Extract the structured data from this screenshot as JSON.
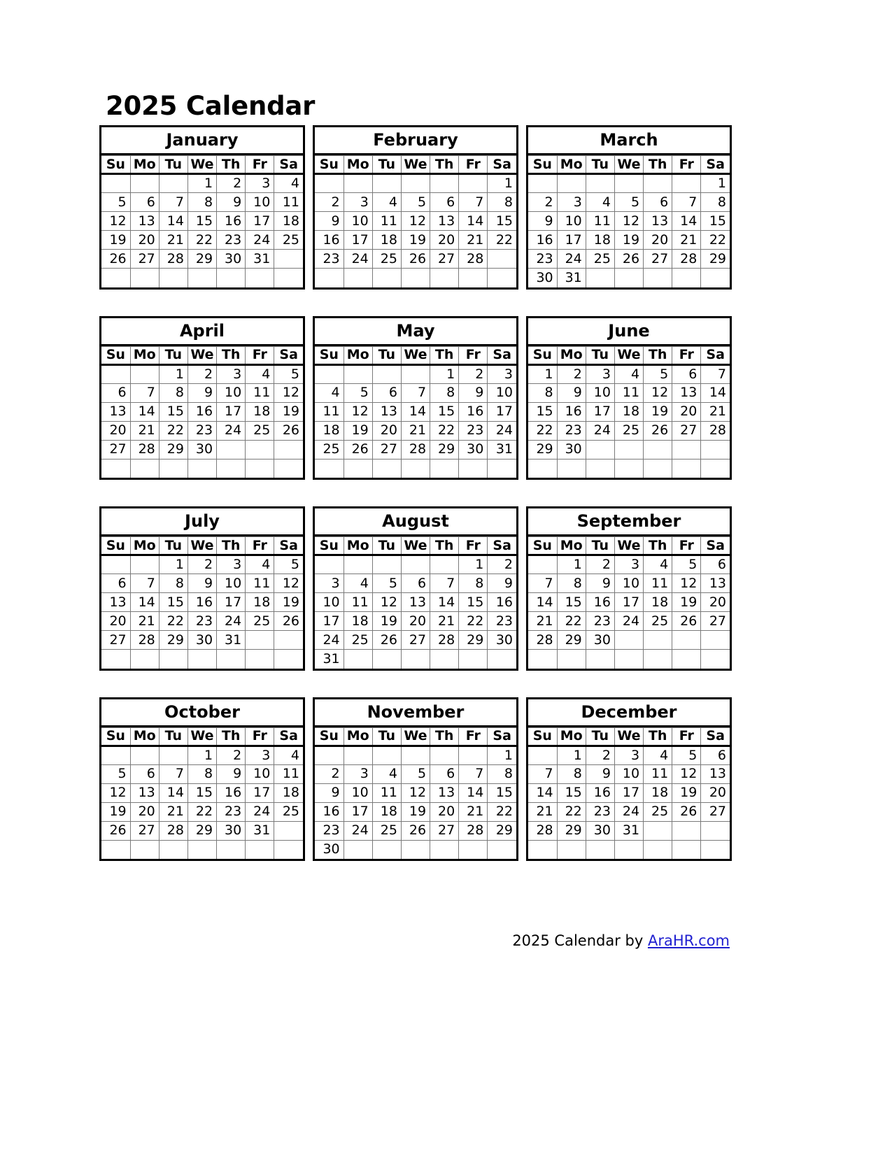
{
  "document": {
    "title": "2025 Calendar",
    "year": "2025"
  },
  "weekdays": [
    "Su",
    "Mo",
    "Tu",
    "We",
    "Th",
    "Fr",
    "Sa"
  ],
  "footer": {
    "text": "2025  Calendar by ",
    "link_label": "AraHR.com",
    "link_color": "#2020d0"
  },
  "colors": {
    "page_background": "#ffffff",
    "text": "#000000",
    "outer_border": "#000000",
    "inner_gridline": "#7a7a7a",
    "link": "#2020d0"
  },
  "calendar_data": {
    "type": "table",
    "year": 2025,
    "week_start": "Sunday",
    "rows_per_month": 6,
    "months": [
      {
        "name": "January",
        "days_in_month": 31,
        "first_weekday": "We",
        "weeks": [
          [
            "",
            "",
            "",
            "1",
            "2",
            "3",
            "4"
          ],
          [
            "5",
            "6",
            "7",
            "8",
            "9",
            "10",
            "11"
          ],
          [
            "12",
            "13",
            "14",
            "15",
            "16",
            "17",
            "18"
          ],
          [
            "19",
            "20",
            "21",
            "22",
            "23",
            "24",
            "25"
          ],
          [
            "26",
            "27",
            "28",
            "29",
            "30",
            "31",
            ""
          ],
          [
            "",
            "",
            "",
            "",
            "",
            "",
            ""
          ]
        ]
      },
      {
        "name": "February",
        "days_in_month": 28,
        "first_weekday": "Sa",
        "weeks": [
          [
            "",
            "",
            "",
            "",
            "",
            "",
            "1"
          ],
          [
            "2",
            "3",
            "4",
            "5",
            "6",
            "7",
            "8"
          ],
          [
            "9",
            "10",
            "11",
            "12",
            "13",
            "14",
            "15"
          ],
          [
            "16",
            "17",
            "18",
            "19",
            "20",
            "21",
            "22"
          ],
          [
            "23",
            "24",
            "25",
            "26",
            "27",
            "28",
            ""
          ],
          [
            "",
            "",
            "",
            "",
            "",
            "",
            ""
          ]
        ]
      },
      {
        "name": "March",
        "days_in_month": 31,
        "first_weekday": "Sa",
        "weeks": [
          [
            "",
            "",
            "",
            "",
            "",
            "",
            "1"
          ],
          [
            "2",
            "3",
            "4",
            "5",
            "6",
            "7",
            "8"
          ],
          [
            "9",
            "10",
            "11",
            "12",
            "13",
            "14",
            "15"
          ],
          [
            "16",
            "17",
            "18",
            "19",
            "20",
            "21",
            "22"
          ],
          [
            "23",
            "24",
            "25",
            "26",
            "27",
            "28",
            "29"
          ],
          [
            "30",
            "31",
            "",
            "",
            "",
            "",
            ""
          ]
        ]
      },
      {
        "name": "April",
        "days_in_month": 30,
        "first_weekday": "Tu",
        "weeks": [
          [
            "",
            "",
            "1",
            "2",
            "3",
            "4",
            "5"
          ],
          [
            "6",
            "7",
            "8",
            "9",
            "10",
            "11",
            "12"
          ],
          [
            "13",
            "14",
            "15",
            "16",
            "17",
            "18",
            "19"
          ],
          [
            "20",
            "21",
            "22",
            "23",
            "24",
            "25",
            "26"
          ],
          [
            "27",
            "28",
            "29",
            "30",
            "",
            "",
            ""
          ],
          [
            "",
            "",
            "",
            "",
            "",
            "",
            ""
          ]
        ]
      },
      {
        "name": "May",
        "days_in_month": 31,
        "first_weekday": "Th",
        "weeks": [
          [
            "",
            "",
            "",
            "",
            "1",
            "2",
            "3"
          ],
          [
            "4",
            "5",
            "6",
            "7",
            "8",
            "9",
            "10"
          ],
          [
            "11",
            "12",
            "13",
            "14",
            "15",
            "16",
            "17"
          ],
          [
            "18",
            "19",
            "20",
            "21",
            "22",
            "23",
            "24"
          ],
          [
            "25",
            "26",
            "27",
            "28",
            "29",
            "30",
            "31"
          ],
          [
            "",
            "",
            "",
            "",
            "",
            "",
            ""
          ]
        ]
      },
      {
        "name": "June",
        "days_in_month": 30,
        "first_weekday": "Su",
        "weeks": [
          [
            "1",
            "2",
            "3",
            "4",
            "5",
            "6",
            "7"
          ],
          [
            "8",
            "9",
            "10",
            "11",
            "12",
            "13",
            "14"
          ],
          [
            "15",
            "16",
            "17",
            "18",
            "19",
            "20",
            "21"
          ],
          [
            "22",
            "23",
            "24",
            "25",
            "26",
            "27",
            "28"
          ],
          [
            "29",
            "30",
            "",
            "",
            "",
            "",
            ""
          ],
          [
            "",
            "",
            "",
            "",
            "",
            "",
            ""
          ]
        ]
      },
      {
        "name": "July",
        "days_in_month": 31,
        "first_weekday": "Tu",
        "weeks": [
          [
            "",
            "",
            "1",
            "2",
            "3",
            "4",
            "5"
          ],
          [
            "6",
            "7",
            "8",
            "9",
            "10",
            "11",
            "12"
          ],
          [
            "13",
            "14",
            "15",
            "16",
            "17",
            "18",
            "19"
          ],
          [
            "20",
            "21",
            "22",
            "23",
            "24",
            "25",
            "26"
          ],
          [
            "27",
            "28",
            "29",
            "30",
            "31",
            "",
            ""
          ],
          [
            "",
            "",
            "",
            "",
            "",
            "",
            ""
          ]
        ]
      },
      {
        "name": "August",
        "days_in_month": 31,
        "first_weekday": "Fr",
        "weeks": [
          [
            "",
            "",
            "",
            "",
            "",
            "1",
            "2"
          ],
          [
            "3",
            "4",
            "5",
            "6",
            "7",
            "8",
            "9"
          ],
          [
            "10",
            "11",
            "12",
            "13",
            "14",
            "15",
            "16"
          ],
          [
            "17",
            "18",
            "19",
            "20",
            "21",
            "22",
            "23"
          ],
          [
            "24",
            "25",
            "26",
            "27",
            "28",
            "29",
            "30"
          ],
          [
            "31",
            "",
            "",
            "",
            "",
            "",
            ""
          ]
        ]
      },
      {
        "name": "September",
        "days_in_month": 30,
        "first_weekday": "Mo",
        "weeks": [
          [
            "",
            "1",
            "2",
            "3",
            "4",
            "5",
            "6"
          ],
          [
            "7",
            "8",
            "9",
            "10",
            "11",
            "12",
            "13"
          ],
          [
            "14",
            "15",
            "16",
            "17",
            "18",
            "19",
            "20"
          ],
          [
            "21",
            "22",
            "23",
            "24",
            "25",
            "26",
            "27"
          ],
          [
            "28",
            "29",
            "30",
            "",
            "",
            "",
            ""
          ],
          [
            "",
            "",
            "",
            "",
            "",
            "",
            ""
          ]
        ]
      },
      {
        "name": "October",
        "days_in_month": 31,
        "first_weekday": "We",
        "weeks": [
          [
            "",
            "",
            "",
            "1",
            "2",
            "3",
            "4"
          ],
          [
            "5",
            "6",
            "7",
            "8",
            "9",
            "10",
            "11"
          ],
          [
            "12",
            "13",
            "14",
            "15",
            "16",
            "17",
            "18"
          ],
          [
            "19",
            "20",
            "21",
            "22",
            "23",
            "24",
            "25"
          ],
          [
            "26",
            "27",
            "28",
            "29",
            "30",
            "31",
            ""
          ],
          [
            "",
            "",
            "",
            "",
            "",
            "",
            ""
          ]
        ]
      },
      {
        "name": "November",
        "days_in_month": 30,
        "first_weekday": "Sa",
        "weeks": [
          [
            "",
            "",
            "",
            "",
            "",
            "",
            "1"
          ],
          [
            "2",
            "3",
            "4",
            "5",
            "6",
            "7",
            "8"
          ],
          [
            "9",
            "10",
            "11",
            "12",
            "13",
            "14",
            "15"
          ],
          [
            "16",
            "17",
            "18",
            "19",
            "20",
            "21",
            "22"
          ],
          [
            "23",
            "24",
            "25",
            "26",
            "27",
            "28",
            "29"
          ],
          [
            "30",
            "",
            "",
            "",
            "",
            "",
            ""
          ]
        ]
      },
      {
        "name": "December",
        "days_in_month": 31,
        "first_weekday": "Mo",
        "weeks": [
          [
            "",
            "1",
            "2",
            "3",
            "4",
            "5",
            "6"
          ],
          [
            "7",
            "8",
            "9",
            "10",
            "11",
            "12",
            "13"
          ],
          [
            "14",
            "15",
            "16",
            "17",
            "18",
            "19",
            "20"
          ],
          [
            "21",
            "22",
            "23",
            "24",
            "25",
            "26",
            "27"
          ],
          [
            "28",
            "29",
            "30",
            "31",
            "",
            "",
            ""
          ],
          [
            "",
            "",
            "",
            "",
            "",
            "",
            ""
          ]
        ]
      }
    ]
  }
}
